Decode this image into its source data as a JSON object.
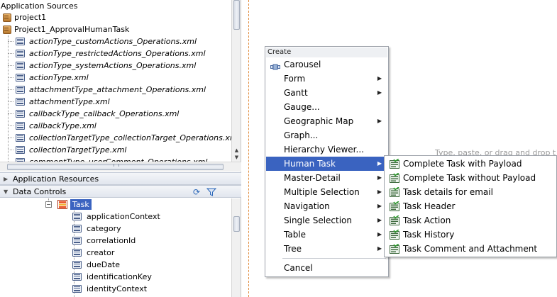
{
  "app_sources": {
    "title": "Application Sources",
    "projects": [
      {
        "label": "project1"
      },
      {
        "label": "Project1_ApprovalHumanTask"
      }
    ],
    "files": [
      "actionType_customActions_Operations.xml",
      "actionType_restrictedActions_Operations.xml",
      "actionType_systemActions_Operations.xml",
      "actionType.xml",
      "attachmentType_attachment_Operations.xml",
      "attachmentType.xml",
      "callbackType_callback_Operations.xml",
      "callbackType.xml",
      "collectionTargetType_collectionTarget_Operations.xml",
      "collectionTargetType.xml",
      "commentType_userComment_Operations.xml"
    ]
  },
  "panels": {
    "app_resources": "Application Resources",
    "data_controls": "Data Controls"
  },
  "data_controls": {
    "root": "Task",
    "fields": [
      "applicationContext",
      "category",
      "correlationId",
      "creator",
      "dueDate",
      "identificationKey",
      "identityContext"
    ]
  },
  "background_text": "Type, paste, or drag and drop t",
  "context_menu": {
    "header": "Create",
    "items": [
      {
        "label": "Carousel",
        "has_submenu": false
      },
      {
        "label": "Form",
        "has_submenu": true
      },
      {
        "label": "Gantt",
        "has_submenu": true
      },
      {
        "label": "Gauge...",
        "has_submenu": false
      },
      {
        "label": "Geographic Map",
        "has_submenu": true
      },
      {
        "label": "Graph...",
        "has_submenu": false
      },
      {
        "label": "Hierarchy Viewer...",
        "has_submenu": false
      },
      {
        "label": "Human Task",
        "has_submenu": true,
        "highlighted": true
      },
      {
        "label": "Master-Detail",
        "has_submenu": true
      },
      {
        "label": "Multiple Selection",
        "has_submenu": true
      },
      {
        "label": "Navigation",
        "has_submenu": true
      },
      {
        "label": "Single Selection",
        "has_submenu": true
      },
      {
        "label": "Table",
        "has_submenu": true
      },
      {
        "label": "Tree",
        "has_submenu": true
      }
    ],
    "cancel": "Cancel",
    "submenu_arrow": "▶"
  },
  "submenu": {
    "items": [
      "Complete Task with Payload",
      "Complete Task without Payload",
      "Task details for email",
      "Task Header",
      "Task Action",
      "Task History",
      "Task Comment and Attachment"
    ]
  },
  "icons": {
    "expand": "+",
    "collapse": "−",
    "tri_right": "▶",
    "tri_down": "▼",
    "scroll_up": "▲",
    "scroll_down": "▼",
    "refresh": "⟳"
  },
  "colors": {
    "selection": "#3a63c0",
    "splitter": "#e08a3a"
  }
}
